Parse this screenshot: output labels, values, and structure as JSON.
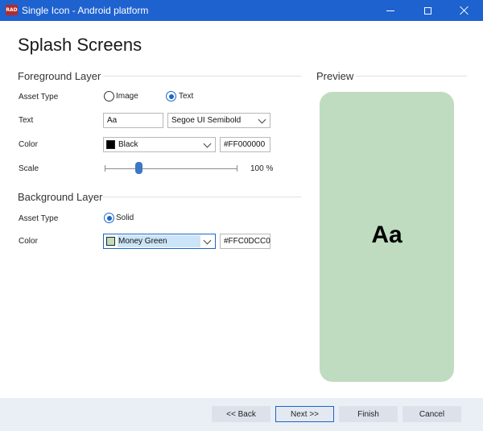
{
  "window": {
    "app_icon": "RAD",
    "title": "Single Icon - Android platform"
  },
  "page": {
    "title": "Splash Screens"
  },
  "foreground": {
    "header": "Foreground Layer",
    "asset_type_label": "Asset Type",
    "asset_options": [
      "Image",
      "Text"
    ],
    "asset_selected": "Text",
    "text_label": "Text",
    "text_value": "Aa",
    "font_value": "Segoe UI Semibold",
    "color_label": "Color",
    "color_name": "Black",
    "color_hex": "#FF000000",
    "color_swatch": "#000000",
    "scale_label": "Scale",
    "scale_value": "100 %",
    "scale_fraction": 0.26
  },
  "background": {
    "header": "Background Layer",
    "asset_type_label": "Asset Type",
    "asset_option": "Solid",
    "color_label": "Color",
    "color_name": "Money Green",
    "color_hex": "#FFC0DCC0",
    "color_swatch": "#c0dcc0"
  },
  "preview": {
    "header": "Preview",
    "text": "Aa",
    "background_color": "#c0dcc0"
  },
  "footer": {
    "back": "<< Back",
    "next": "Next >>",
    "finish": "Finish",
    "cancel": "Cancel"
  }
}
